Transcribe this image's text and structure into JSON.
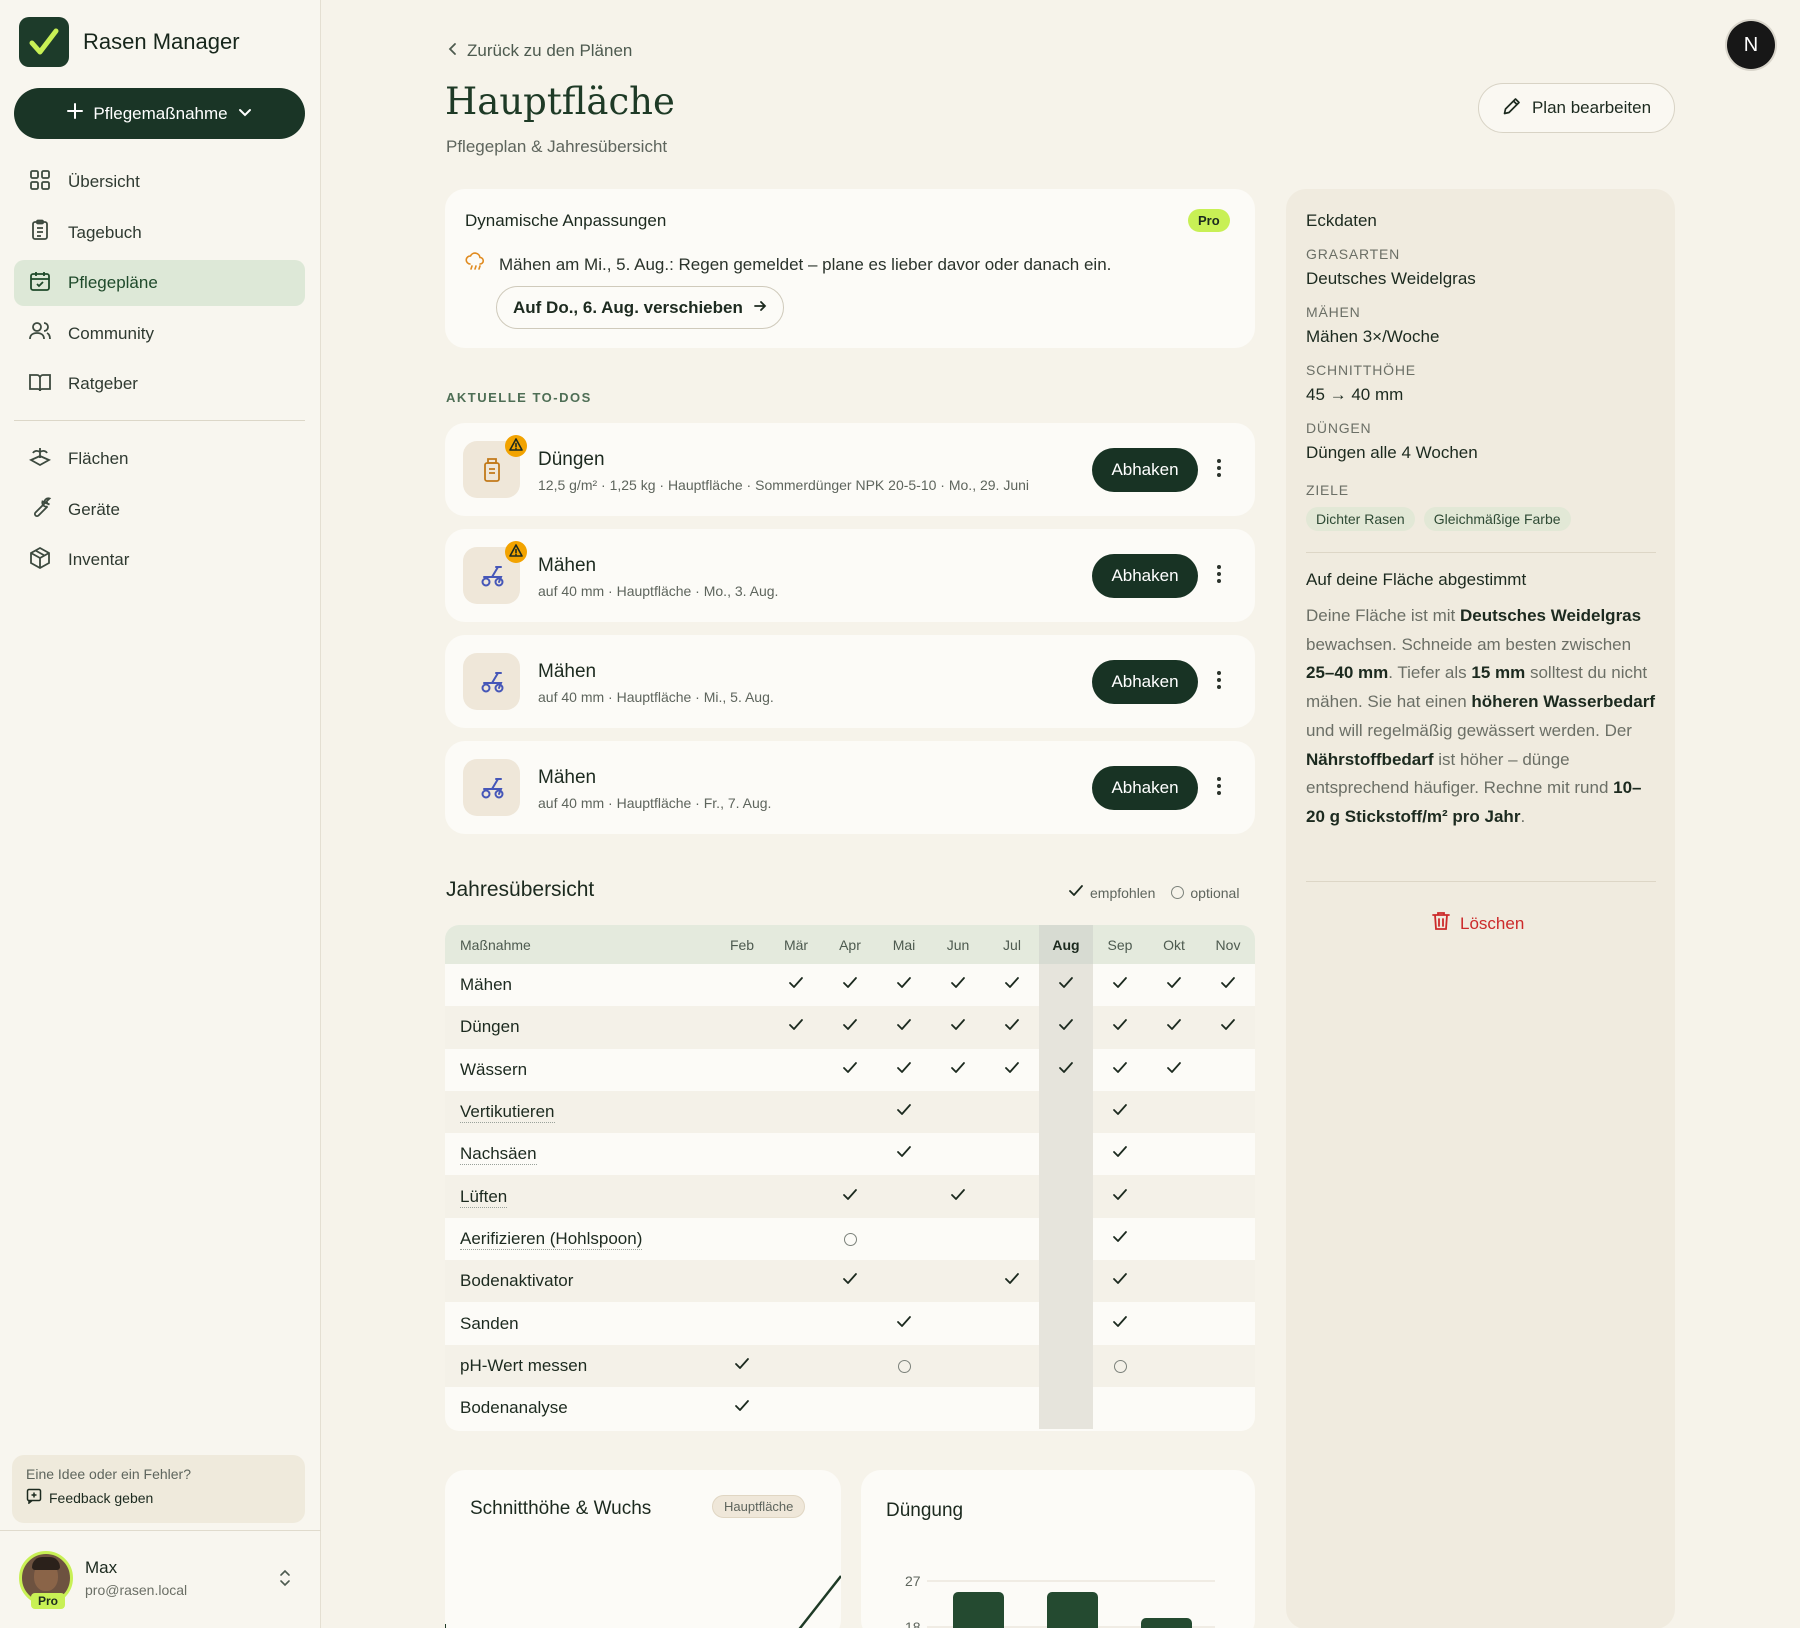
{
  "app": {
    "name": "Rasen Manager"
  },
  "sidebar": {
    "new_button": "Pflegemaßnahme",
    "items": [
      {
        "label": "Übersicht",
        "icon": "grid-icon"
      },
      {
        "label": "Tagebuch",
        "icon": "clipboard-icon"
      },
      {
        "label": "Pflegepläne",
        "icon": "calendar-check-icon"
      },
      {
        "label": "Community",
        "icon": "users-icon"
      },
      {
        "label": "Ratgeber",
        "icon": "book-icon"
      }
    ],
    "items2": [
      {
        "label": "Flächen",
        "icon": "layers-icon"
      },
      {
        "label": "Geräte",
        "icon": "wrench-icon"
      },
      {
        "label": "Inventar",
        "icon": "box-icon"
      }
    ],
    "active": "Pflegepläne",
    "feedback": {
      "question": "Eine Idee oder ein Fehler?",
      "link": "Feedback geben"
    },
    "user": {
      "name": "Max",
      "email": "pro@rasen.local",
      "badge": "Pro"
    }
  },
  "header": {
    "back": "Zurück zu den Plänen",
    "title": "Hauptfläche",
    "subtitle": "Pflegeplan & Jahresübersicht",
    "edit_button": "Plan bearbeiten",
    "avatar_letter": "N"
  },
  "dynamic": {
    "title": "Dynamische Anpassungen",
    "badge": "Pro",
    "message": "Mähen am Mi., 5. Aug.: Regen gemeldet – plane es lieber davor oder danach ein.",
    "button": "Auf Do., 6. Aug. verschieben"
  },
  "todos": {
    "section_label": "AKTUELLE TO-DOS",
    "action_label": "Abhaken",
    "items": [
      {
        "title": "Düngen",
        "meta": "12,5 g/m² · 1,25 kg · Hauptfläche · Sommerdünger NPK 20-5-10 · Mo., 29. Juni",
        "icon": "fertilizer-icon",
        "warning": true
      },
      {
        "title": "Mähen",
        "meta": "auf 40 mm · Hauptfläche · Mo., 3. Aug.",
        "icon": "mower-icon",
        "warning": true
      },
      {
        "title": "Mähen",
        "meta": "auf 40 mm · Hauptfläche · Mi., 5. Aug.",
        "icon": "mower-icon",
        "warning": false
      },
      {
        "title": "Mähen",
        "meta": "auf 40 mm · Hauptfläche · Fr., 7. Aug.",
        "icon": "mower-icon",
        "warning": false
      }
    ]
  },
  "year": {
    "title": "Jahresübersicht",
    "legend_recommended": "empfohlen",
    "legend_optional": "optional",
    "col_header": "Maßnahme",
    "months": [
      "Feb",
      "Mär",
      "Apr",
      "Mai",
      "Jun",
      "Jul",
      "Aug",
      "Sep",
      "Okt",
      "Nov"
    ],
    "current_month": "Aug",
    "rows": [
      {
        "name": "Mähen",
        "dotted": false,
        "cells": [
          "",
          "c",
          "c",
          "c",
          "c",
          "c",
          "c",
          "c",
          "c",
          "c"
        ]
      },
      {
        "name": "Düngen",
        "dotted": false,
        "cells": [
          "",
          "c",
          "c",
          "c",
          "c",
          "c",
          "c",
          "c",
          "c",
          "c"
        ]
      },
      {
        "name": "Wässern",
        "dotted": false,
        "cells": [
          "",
          "",
          "c",
          "c",
          "c",
          "c",
          "c",
          "c",
          "c",
          ""
        ]
      },
      {
        "name": "Vertikutieren",
        "dotted": true,
        "cells": [
          "",
          "",
          "",
          "c",
          "",
          "",
          "",
          "c",
          "",
          ""
        ]
      },
      {
        "name": "Nachsäen",
        "dotted": true,
        "cells": [
          "",
          "",
          "",
          "c",
          "",
          "",
          "",
          "c",
          "",
          ""
        ]
      },
      {
        "name": "Lüften",
        "dotted": true,
        "cells": [
          "",
          "",
          "c",
          "",
          "c",
          "",
          "",
          "c",
          "",
          ""
        ]
      },
      {
        "name": "Aerifizieren (Hohlspoon)",
        "dotted": true,
        "cells": [
          "",
          "",
          "o",
          "",
          "",
          "",
          "",
          "c",
          "",
          ""
        ]
      },
      {
        "name": "Bodenaktivator",
        "dotted": false,
        "cells": [
          "",
          "",
          "c",
          "",
          "",
          "c",
          "",
          "c",
          "",
          ""
        ]
      },
      {
        "name": "Sanden",
        "dotted": false,
        "cells": [
          "",
          "",
          "",
          "c",
          "",
          "",
          "",
          "c",
          "",
          ""
        ]
      },
      {
        "name": "pH-Wert messen",
        "dotted": false,
        "cells": [
          "c",
          "",
          "",
          "o",
          "",
          "",
          "",
          "o",
          "",
          ""
        ]
      },
      {
        "name": "Bodenanalyse",
        "dotted": false,
        "cells": [
          "c",
          "",
          "",
          "",
          "",
          "",
          "",
          "",
          "",
          ""
        ]
      }
    ]
  },
  "cards": {
    "growth": {
      "title": "Schnitthöhe & Wuchs",
      "badge": "Hauptfläche"
    },
    "fertilizing": {
      "title": "Düngung",
      "y_ticks": [
        "27",
        "18"
      ]
    }
  },
  "panel": {
    "title": "Eckdaten",
    "grass_label": "GRASARTEN",
    "grass": "Deutsches Weidelgras",
    "mow_label": "MÄHEN",
    "mow": "Mähen 3×/Woche",
    "height_label": "SCHNITTHÖHE",
    "height": "45 → 40 mm",
    "fert_label": "DÜNGEN",
    "fert": "Düngen alle 4 Wochen",
    "goals_label": "ZIELE",
    "goals": [
      "Dichter Rasen",
      "Gleichmäßige Farbe"
    ],
    "tailored_title": "Auf deine Fläche abgestimmt",
    "tailored_parts": [
      {
        "t": "Deine Fläche ist mit ",
        "b": false
      },
      {
        "t": "Deutsches Weidelgras",
        "b": true
      },
      {
        "t": " bewachsen. Schneide am besten zwischen ",
        "b": false
      },
      {
        "t": "25–40 mm",
        "b": true
      },
      {
        "t": ". Tiefer als ",
        "b": false
      },
      {
        "t": "15 mm",
        "b": true
      },
      {
        "t": " solltest du nicht mähen. Sie hat einen ",
        "b": false
      },
      {
        "t": "höheren Wasserbedarf",
        "b": true
      },
      {
        "t": " und will regelmäßig gewässert werden. Der ",
        "b": false
      },
      {
        "t": "Nährstoffbedarf",
        "b": true
      },
      {
        "t": " ist höher – dünge entsprechend häufiger. Rechne mit rund ",
        "b": false
      },
      {
        "t": "10–20 g Stickstoff/m² pro Jahr",
        "b": true
      },
      {
        "t": ".",
        "b": false
      }
    ],
    "delete": "Löschen"
  },
  "colors": {
    "primary": "#183324",
    "accent": "#c8f055",
    "warning": "#f2a300",
    "danger": "#cc2a2a"
  }
}
